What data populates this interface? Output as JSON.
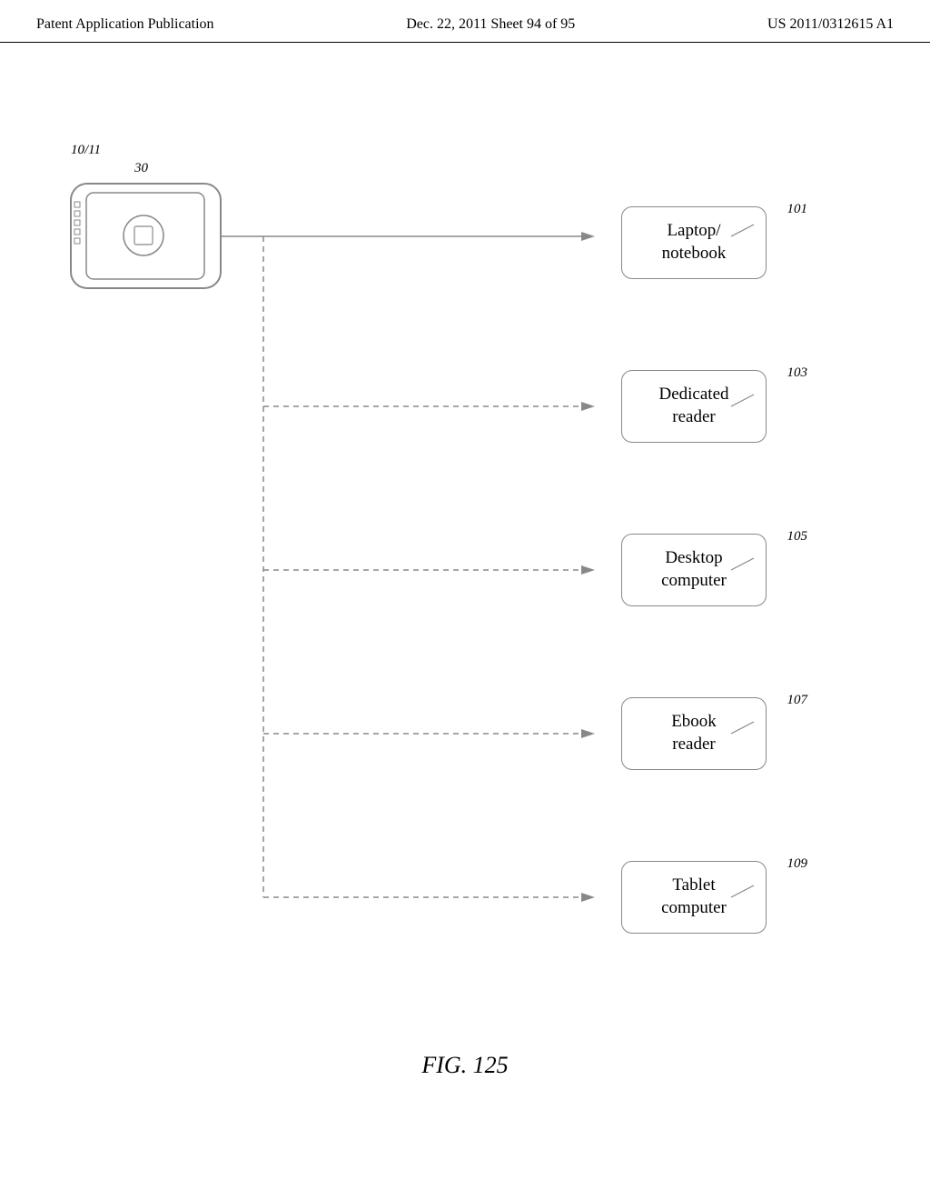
{
  "header": {
    "left": "Patent Application Publication",
    "center": "Dec. 22, 2011   Sheet 94 of 95",
    "right": "US 2011/0312615 A1"
  },
  "diagram": {
    "device_label_main": "10/11",
    "device_label_sub": "30",
    "nodes": [
      {
        "id": "101",
        "label": "Laptop/\nnotebook",
        "ref": "101"
      },
      {
        "id": "103",
        "label": "Dedicated\nreader",
        "ref": "103"
      },
      {
        "id": "105",
        "label": "Desktop\ncomputer",
        "ref": "105"
      },
      {
        "id": "107",
        "label": "Ebook\nreader",
        "ref": "107"
      },
      {
        "id": "109",
        "label": "Tablet\ncomputer",
        "ref": "109"
      }
    ],
    "fig_caption": "FIG. 125"
  }
}
